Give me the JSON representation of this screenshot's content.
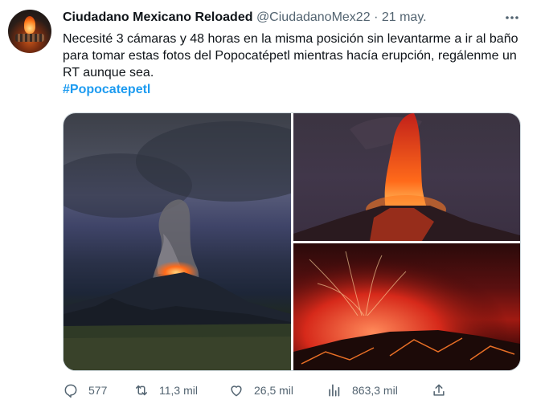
{
  "tweet": {
    "author_name": "Ciudadano Mexicano Reloaded",
    "author_handle": "@CiudadanoMex22",
    "separator": "·",
    "date": "21 may.",
    "text": "Necesité 3 cámaras y 48 horas en la misma posición sin levantarme a ir al baño para tomar estas fotos del Popocatépetl mientras hacía erupción, regálenme un RT aunque sea.",
    "hashtag": "#Popocatepetl"
  },
  "media": {
    "images": [
      {
        "name": "volcano-photo-1",
        "subject": "Popocatépetl erupting at dusk with ash plume"
      },
      {
        "name": "volcano-photo-2",
        "subject": "Popocatépetl lava fountain at night"
      },
      {
        "name": "volcano-photo-3",
        "subject": "Popocatépetl lava flows in red glow"
      }
    ]
  },
  "actions": {
    "replies": "577",
    "retweets": "11,3 mil",
    "likes": "26,5 mil",
    "views": "863,3 mil"
  },
  "colors": {
    "accent": "#1d9bf0",
    "text": "#0f1419",
    "secondary": "#536471",
    "border": "#cfd9de"
  },
  "icons": [
    "more-icon",
    "reply-icon",
    "retweet-icon",
    "like-icon",
    "views-icon",
    "share-icon"
  ]
}
